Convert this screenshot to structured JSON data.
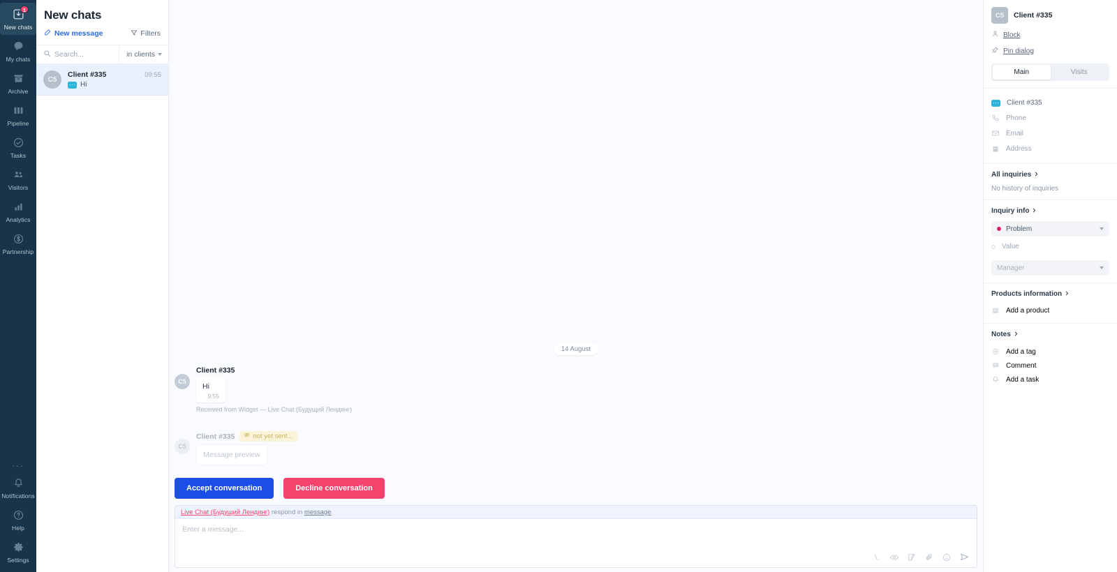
{
  "rail": {
    "top_items": [
      {
        "label": "New chats",
        "icon": "new-chats-icon",
        "badge": "1",
        "active": true
      },
      {
        "label": "My chats",
        "icon": "chat-bubble-icon",
        "badge": "",
        "active": false
      },
      {
        "label": "Archive",
        "icon": "archive-box-icon",
        "badge": "",
        "active": false
      },
      {
        "label": "Pipeline",
        "icon": "pipeline-columns-icon",
        "badge": "",
        "active": false
      },
      {
        "label": "Tasks",
        "icon": "check-circle-icon",
        "badge": "",
        "active": false
      },
      {
        "label": "Visitors",
        "icon": "visitors-people-icon",
        "badge": "",
        "active": false
      },
      {
        "label": "Analytics",
        "icon": "bar-chart-icon",
        "badge": "",
        "active": false
      },
      {
        "label": "Partnership",
        "icon": "dollar-circle-icon",
        "badge": "",
        "active": false
      }
    ],
    "more_dots": "...",
    "bottom_items": [
      {
        "label": "Notifications",
        "icon": "bell-icon"
      },
      {
        "label": "Help",
        "icon": "question-circle-icon"
      },
      {
        "label": "Settings",
        "icon": "gear-icon"
      }
    ]
  },
  "list": {
    "title": "New chats",
    "new_message_label": "New message",
    "filters_label": "Filters",
    "search_placeholder": "Search...",
    "search_value": "",
    "scope_label": "in clients",
    "rows": [
      {
        "avatar": "C5",
        "name": "Client #335",
        "time": "09:55",
        "preview": "Hi",
        "channel": "live-chat-icon"
      }
    ]
  },
  "thread": {
    "date_chip": "14 August",
    "messages": [
      {
        "avatar": "C5",
        "author": "Client #335",
        "text": "Hi",
        "time": "9:55",
        "meta": "Received from Widget — Live Chat (Будущий Лендинг)",
        "pending": "",
        "muted": false
      },
      {
        "avatar": "C5",
        "author": "Client #335",
        "text": "Message preview",
        "time": "",
        "meta": "",
        "pending": "not yet sent...",
        "muted": true
      }
    ]
  },
  "actions": {
    "accept_label": "Accept conversation",
    "decline_label": "Decline conversation"
  },
  "composer": {
    "channel": "Live Chat (Будущий Лендинг)",
    "respond_in": "respond in",
    "mode": "message",
    "placeholder": "Enter a message...",
    "value": "",
    "tools": [
      {
        "name": "variables-icon",
        "glyph": "\\.."
      },
      {
        "name": "eye-icon",
        "glyph": ""
      },
      {
        "name": "sticker-icon",
        "glyph": ""
      },
      {
        "name": "paperclip-icon",
        "glyph": ""
      },
      {
        "name": "emoji-icon",
        "glyph": ""
      },
      {
        "name": "send-icon",
        "glyph": ""
      }
    ]
  },
  "panel": {
    "avatar": "C5",
    "name": "Client #335",
    "block_label": "Block",
    "pin_label": "Pin dialog",
    "tabs": [
      {
        "label": "Main",
        "active": true
      },
      {
        "label": "Visits",
        "active": false
      }
    ],
    "contact_fields": [
      {
        "label": "Client #335",
        "icon": "live-chat-icon",
        "placeholder": false
      },
      {
        "label": "Phone",
        "icon": "phone-icon",
        "placeholder": true
      },
      {
        "label": "Email",
        "icon": "envelope-icon",
        "placeholder": true
      },
      {
        "label": "Address",
        "icon": "building-icon",
        "placeholder": true
      }
    ],
    "inquiries_title": "All inquiries",
    "inquiries_note": "No history of inquiries",
    "inquiry_info_title": "Inquiry info",
    "inquiry_status": "Problem",
    "inquiry_status_color": "#e01f6e",
    "inquiry_value": "Value",
    "inquiry_manager": "Manager",
    "products_title": "Products information",
    "add_product": "Add a product",
    "notes_title": "Notes",
    "add_tag": "Add a tag",
    "comment": "Comment",
    "add_task": "Add a task"
  }
}
